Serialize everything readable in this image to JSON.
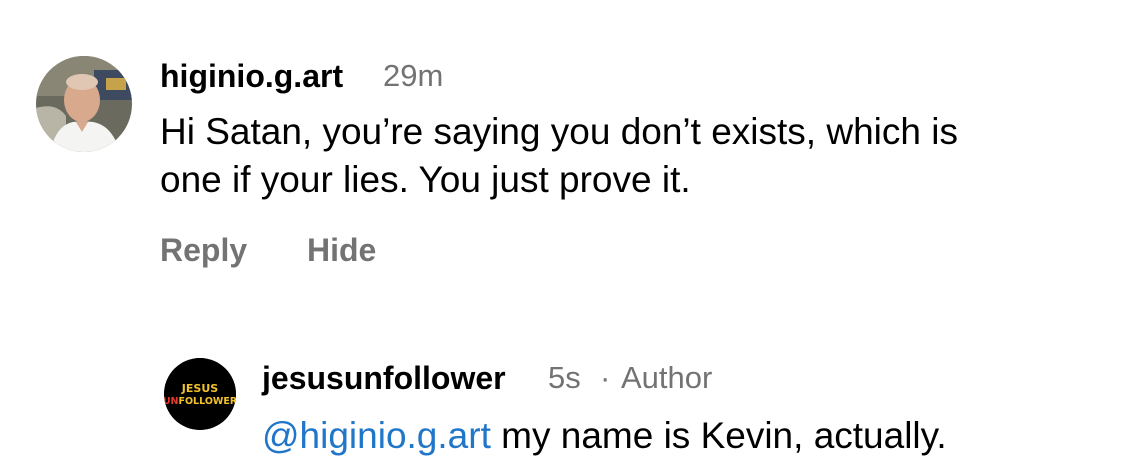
{
  "colors": {
    "background": "#ffffff",
    "text": "#000000",
    "secondary": "#737373",
    "mention": "#2076c9",
    "logo_jesus": "#f2c22b",
    "logo_un": "#e63a2e"
  },
  "comments": [
    {
      "username": "higinio.g.art",
      "time": "29m",
      "avatar_icon": "profile-photo",
      "text_lines": [
        "Hi Satan, you’re saying you don’t exists, which is",
        "one if your lies. You just prove it."
      ],
      "actions": {
        "reply": "Reply",
        "hide": "Hide"
      }
    },
    {
      "username": "jesusunfollower",
      "time": "5s",
      "separator": "·",
      "badge": "Author",
      "avatar_icon": "jesus-unfollower-logo",
      "avatar_logo": {
        "line1": "JESUS",
        "line2_prefix": "UN",
        "line2_suffix": "FOLLOWER"
      },
      "mention": "@higinio.g.art",
      "text": " my name is Kevin, actually."
    }
  ]
}
